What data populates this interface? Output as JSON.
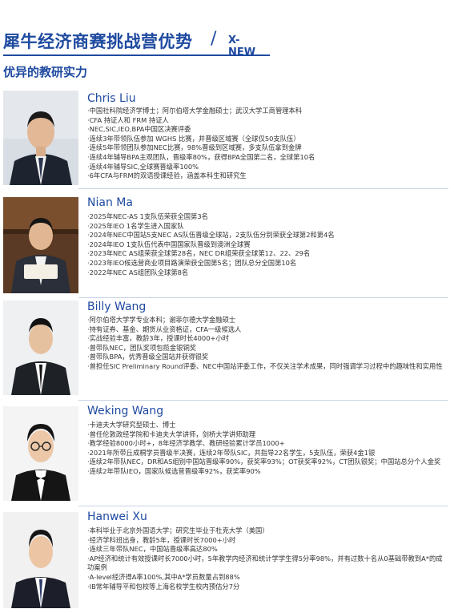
{
  "header": {
    "title": "犀牛经济商赛挑战营优势",
    "slash": "/",
    "tag": "X-NEW",
    "section": "优异的教研实力"
  },
  "people": [
    {
      "name": "Chris Liu",
      "lines": [
        "·中国社科院经济学博士；阿尔伯塔大学金融硕士；武汉大学工商管理本科",
        "·CFA 持证人和 FRM 持证人",
        "·NEC,SIC,IEO,BPA中国区决赛评委",
        "·连续3年带领队伍参加 WGHS 比赛，并晋级区域赛（全球仅50支队伍）",
        "·连续5年带领团队参加NEC比赛，98%晋级到区域赛，多支队伍拿到金牌",
        "·连续4年辅导BPA主观团队，晋级率80%，获得BPA全国第二名，全球第10名",
        "·连续4年辅导SIC,全球赛晋级率100%",
        "·6年CFA与FRM的双语授课经验，涵盖本科生和研究生"
      ]
    },
    {
      "name": "Nian Ma",
      "lines": [
        "·2025年NEC-AS 1支队伍荣获全国第3名",
        "·2025年IEO 1名学生进入国家队",
        "·2024年NEC中国站5支NEC AS队伍晋级全球站，2支队伍分别荣获全球第2和第4名",
        "·2024年IEO 1支队伍代表中国国家队晋级到澳洲全球赛",
        "·2023年NEC AS组荣获全球第28名，NEC DR组荣获全球第12、22、29名",
        "·2023年IEO候选营商业项目路演荣获全国第5名；团队总分全国第10名",
        "·2022年NEC AS组团队全球第8名"
      ]
    },
    {
      "name": "Billy Wang",
      "lines": [
        "·阿尔伯塔大学学专业本科；谢菲尔德大学金融硕士",
        "·持有证券、基金、期货从业资格证，CFA一级候选人",
        "·实战经验丰富，教龄3年，授课时长4000+小时",
        "·曾带队NEC，团队奖项包揽金银铜奖",
        "·曾带队BPA，优秀晋级全国站并获得银奖",
        "·曾担任SIC Preliminary Round评委、NEC中国站评委工作，不仅关注学术成果，同时强调学习过程中的趣味性和实用性"
      ]
    },
    {
      "name": "Weking Wang",
      "lines": [
        "·卡迪夫大学研究型硕士、博士",
        "·曾任伦敦政经学院和卡迪夫大学讲师，剑桥大学讲师助理",
        "·教学经验8000小时+，8年经济学教学、教研经验累计学员1000+",
        "·2021年所带丘成桐学员晋级半决赛，连续2年带队SIC，共指导22名学生，5支队伍，荣获4金1银",
        "·连续2年带队NEC，DR和AS组别中国站晋级率90%，获奖率93%；OT获奖率92%，CT团队银奖；中国站总分个人金奖",
        "·连续2年带队IEO，国家队候选营晋级率92%，获奖率90%"
      ]
    },
    {
      "name": "Hanwei Xu",
      "lines": [
        "·本科毕业于北京外国语大学；研究生毕业于杜克大学（美国）",
        "·经济学科班出身，教龄5年，授课时长7000+小时",
        "·连续三年带队NEC，中国站晋级率高达80%",
        "·AP经济和统计有效授课时长7000小时，5年教学内经济和统计学学生得5分率98%，并有过数十名从0基础带教到A*的成功案例",
        "·A-level经济得A率100%,其中A*学员数量占到88%",
        "·IB常年辅导平和包校等上海名校学生校内预估分7分"
      ]
    }
  ],
  "colors": {
    "accent": "#1f4aa0",
    "text": "#333333"
  }
}
